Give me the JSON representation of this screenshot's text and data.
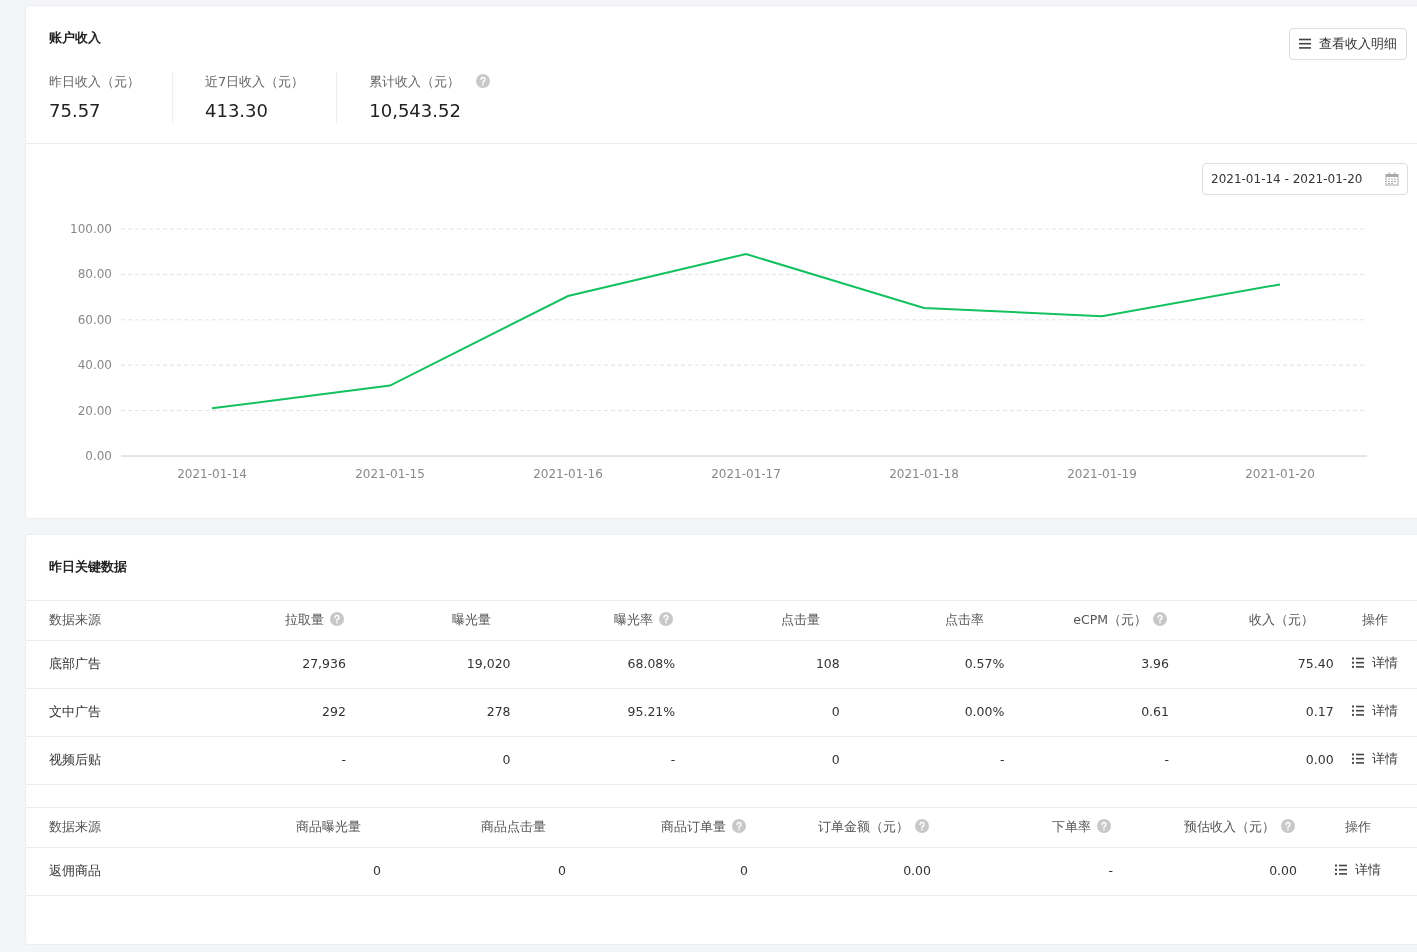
{
  "income": {
    "title": "账户收入",
    "detail_button": "查看收入明细",
    "stats": [
      {
        "label": "昨日收入（元）",
        "value": "75.57",
        "help": false
      },
      {
        "label": "近7日收入（元）",
        "value": "413.30",
        "help": false
      },
      {
        "label": "累计收入（元）",
        "value": "10,543.52",
        "help": true
      }
    ],
    "date_range": "2021-01-14 - 2021-01-20",
    "chart_data": {
      "type": "line",
      "categories": [
        "2021-01-14",
        "2021-01-15",
        "2021-01-16",
        "2021-01-17",
        "2021-01-18",
        "2021-01-19",
        "2021-01-20"
      ],
      "grid": true,
      "series": [
        {
          "color": "#13c15e",
          "values": [
            21.0,
            31.0,
            70.5,
            89.0,
            65.2,
            61.6,
            75.6
          ]
        }
      ],
      "ylim": [
        0,
        100
      ],
      "yticks": [
        {
          "value": 0,
          "label": "0.00"
        },
        {
          "value": 20,
          "label": "20.00"
        },
        {
          "value": 40,
          "label": "40.00"
        },
        {
          "value": 60,
          "label": "60.00"
        },
        {
          "value": 80,
          "label": "80.00"
        },
        {
          "value": 100,
          "label": "100.00"
        }
      ]
    }
  },
  "key_data": {
    "title": "昨日关键数据",
    "tables": [
      {
        "columns": [
          {
            "label": "数据来源",
            "help": false
          },
          {
            "label": "拉取量",
            "help": true
          },
          {
            "label": "曝光量",
            "help": false
          },
          {
            "label": "曝光率",
            "help": true
          },
          {
            "label": "点击量",
            "help": false
          },
          {
            "label": "点击率",
            "help": false
          },
          {
            "label": "eCPM（元）",
            "help": true
          },
          {
            "label": "收入（元）",
            "help": false
          },
          {
            "label": "操作",
            "help": false
          }
        ],
        "rows": [
          {
            "cells": [
              "底部广告",
              "27,936",
              "19,020",
              "68.08%",
              "108",
              "0.57%",
              "3.96",
              "75.40"
            ],
            "action": "详情"
          },
          {
            "cells": [
              "文中广告",
              "292",
              "278",
              "95.21%",
              "0",
              "0.00%",
              "0.61",
              "0.17"
            ],
            "action": "详情"
          },
          {
            "cells": [
              "视频后贴",
              "-",
              "0",
              "-",
              "0",
              "-",
              "-",
              "0.00"
            ],
            "action": "详情"
          }
        ]
      },
      {
        "columns": [
          {
            "label": "数据来源",
            "help": false
          },
          {
            "label": "商品曝光量",
            "help": false
          },
          {
            "label": "商品点击量",
            "help": false
          },
          {
            "label": "商品订单量",
            "help": true
          },
          {
            "label": "订单金额（元）",
            "help": true
          },
          {
            "label": "下单率",
            "help": true
          },
          {
            "label": "预估收入（元）",
            "help": true
          },
          {
            "label": "操作",
            "help": false
          }
        ],
        "rows": [
          {
            "cells": [
              "返佣商品",
              "0",
              "0",
              "0",
              "0.00",
              "-",
              "0.00"
            ],
            "action": "详情"
          }
        ]
      }
    ]
  }
}
